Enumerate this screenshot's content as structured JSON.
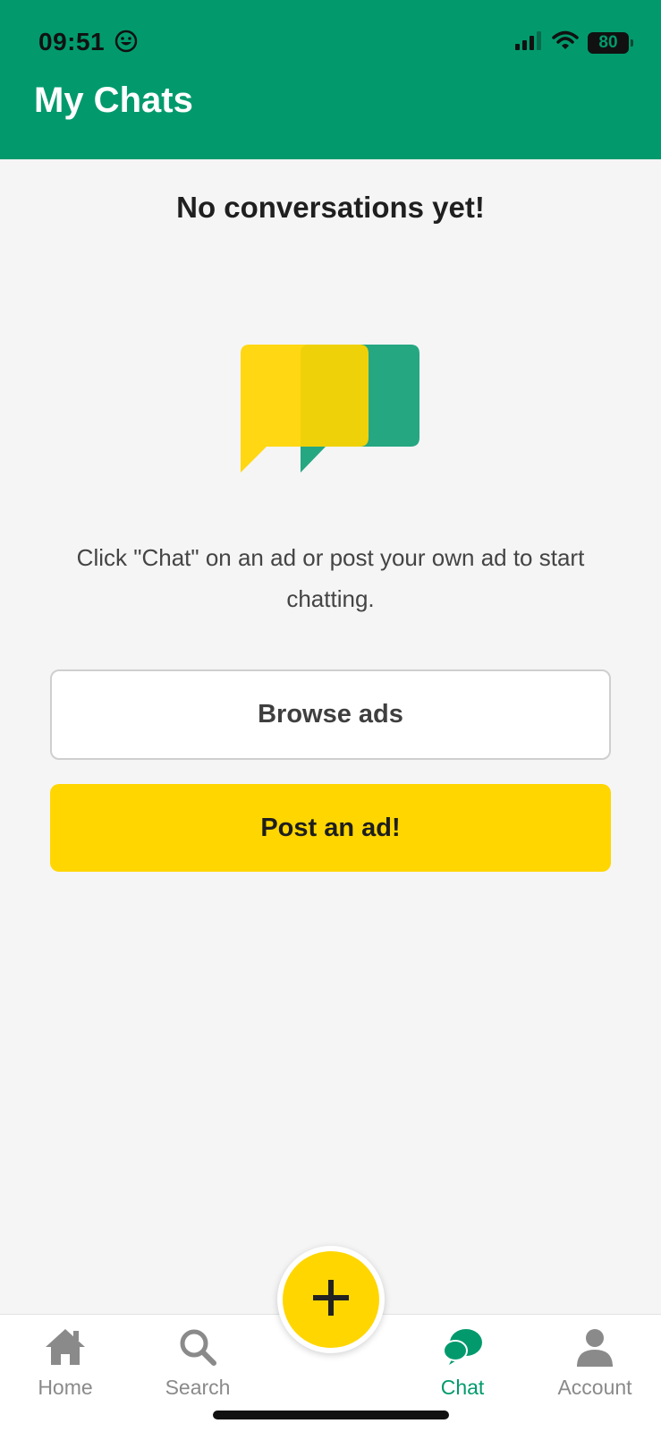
{
  "status_bar": {
    "time": "09:51",
    "battery": "80"
  },
  "header": {
    "title": "My Chats"
  },
  "empty_state": {
    "title": "No conversations yet!",
    "message": "Click \"Chat\" on an ad or post your own ad to start chatting."
  },
  "buttons": {
    "browse": "Browse ads",
    "post": "Post an ad!"
  },
  "tabs": [
    {
      "label": "Home",
      "icon": "home-icon"
    },
    {
      "label": "Search",
      "icon": "search-icon"
    },
    {
      "label": "Chat",
      "icon": "chat-icon",
      "active": true
    },
    {
      "label": "Account",
      "icon": "account-icon"
    }
  ],
  "colors": {
    "brand_green": "#029a6c",
    "accent_yellow": "#ffd600",
    "inactive_gray": "#8a8a8a"
  }
}
